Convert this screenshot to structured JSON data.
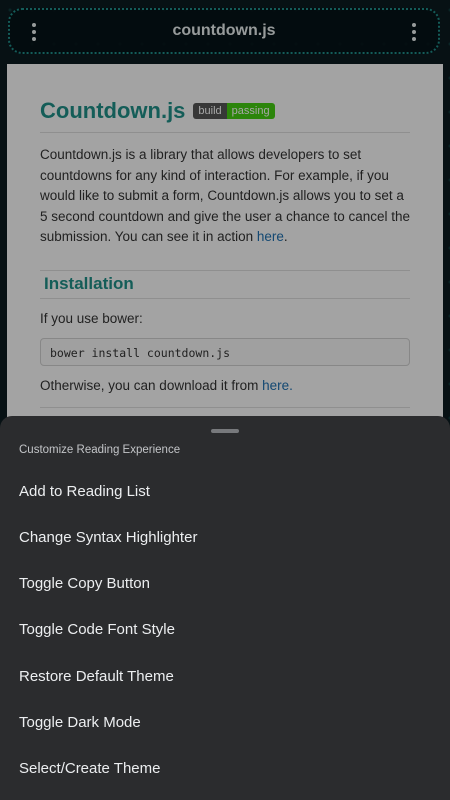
{
  "topbar": {
    "title": "countdown.js",
    "left_icon": "more-vert-icon",
    "right_icon": "more-vert-icon"
  },
  "doc": {
    "heading": "Countdown.js",
    "badge_left": "build",
    "badge_right": "passing",
    "intro_text": "Countdown.js is a library that allows developers to set countdowns for any kind of interaction. For example, if you would like to submit a form, Countdown.js allows you to set a 5 second countdown and give the user a chance to cancel the submission. You can see it in action ",
    "intro_link": "here",
    "intro_end": ".",
    "install_heading": "Installation",
    "bower_text": "If you use bower:",
    "code": "bower install countdown.js",
    "download_text": "Otherwise, you can download it from ",
    "download_link": "here."
  },
  "sheet": {
    "title": "Customize Reading Experience",
    "items": [
      "Add to Reading List",
      "Change Syntax Highlighter",
      "Toggle Copy Button",
      "Toggle Code Font Style",
      "Restore Default Theme",
      "Toggle Dark Mode",
      "Select/Create Theme"
    ]
  },
  "colors": {
    "accent": "#1f8f87",
    "sheet_bg": "#2b2c2e",
    "badge_pass": "#44cc11"
  }
}
